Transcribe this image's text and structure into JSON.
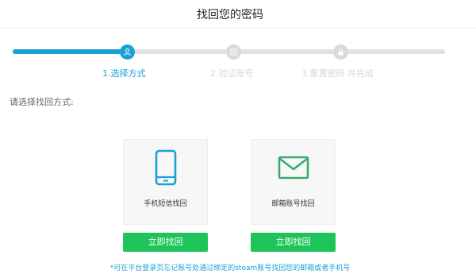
{
  "header": {
    "title": "找回您的密码"
  },
  "steps": [
    {
      "label": "1.选择方式",
      "icon": "user-icon",
      "state": "active"
    },
    {
      "label": "2.验证账号",
      "icon": "shield-icon",
      "state": "inactive"
    },
    {
      "label": "3.重置密码 并完成",
      "icon": "lock-icon",
      "state": "inactive"
    }
  ],
  "progress": {
    "completed_fraction": 0.27
  },
  "prompt": "请选择找回方式:",
  "options": [
    {
      "label": "手机短信找回",
      "icon": "phone-icon",
      "button_label": "立即找回"
    },
    {
      "label": "邮箱账号找回",
      "icon": "envelope-icon",
      "button_label": "立即找回"
    }
  ],
  "note": "*可在平台登录页忘记账号处通过绑定的steam账号找回您的邮箱或者手机号",
  "colors": {
    "accent": "#1aa1d6",
    "button": "#1ec45a",
    "phone_icon": "#1aa1d6",
    "envelope_icon": "#3aaa72",
    "inactive": "#dadada"
  }
}
